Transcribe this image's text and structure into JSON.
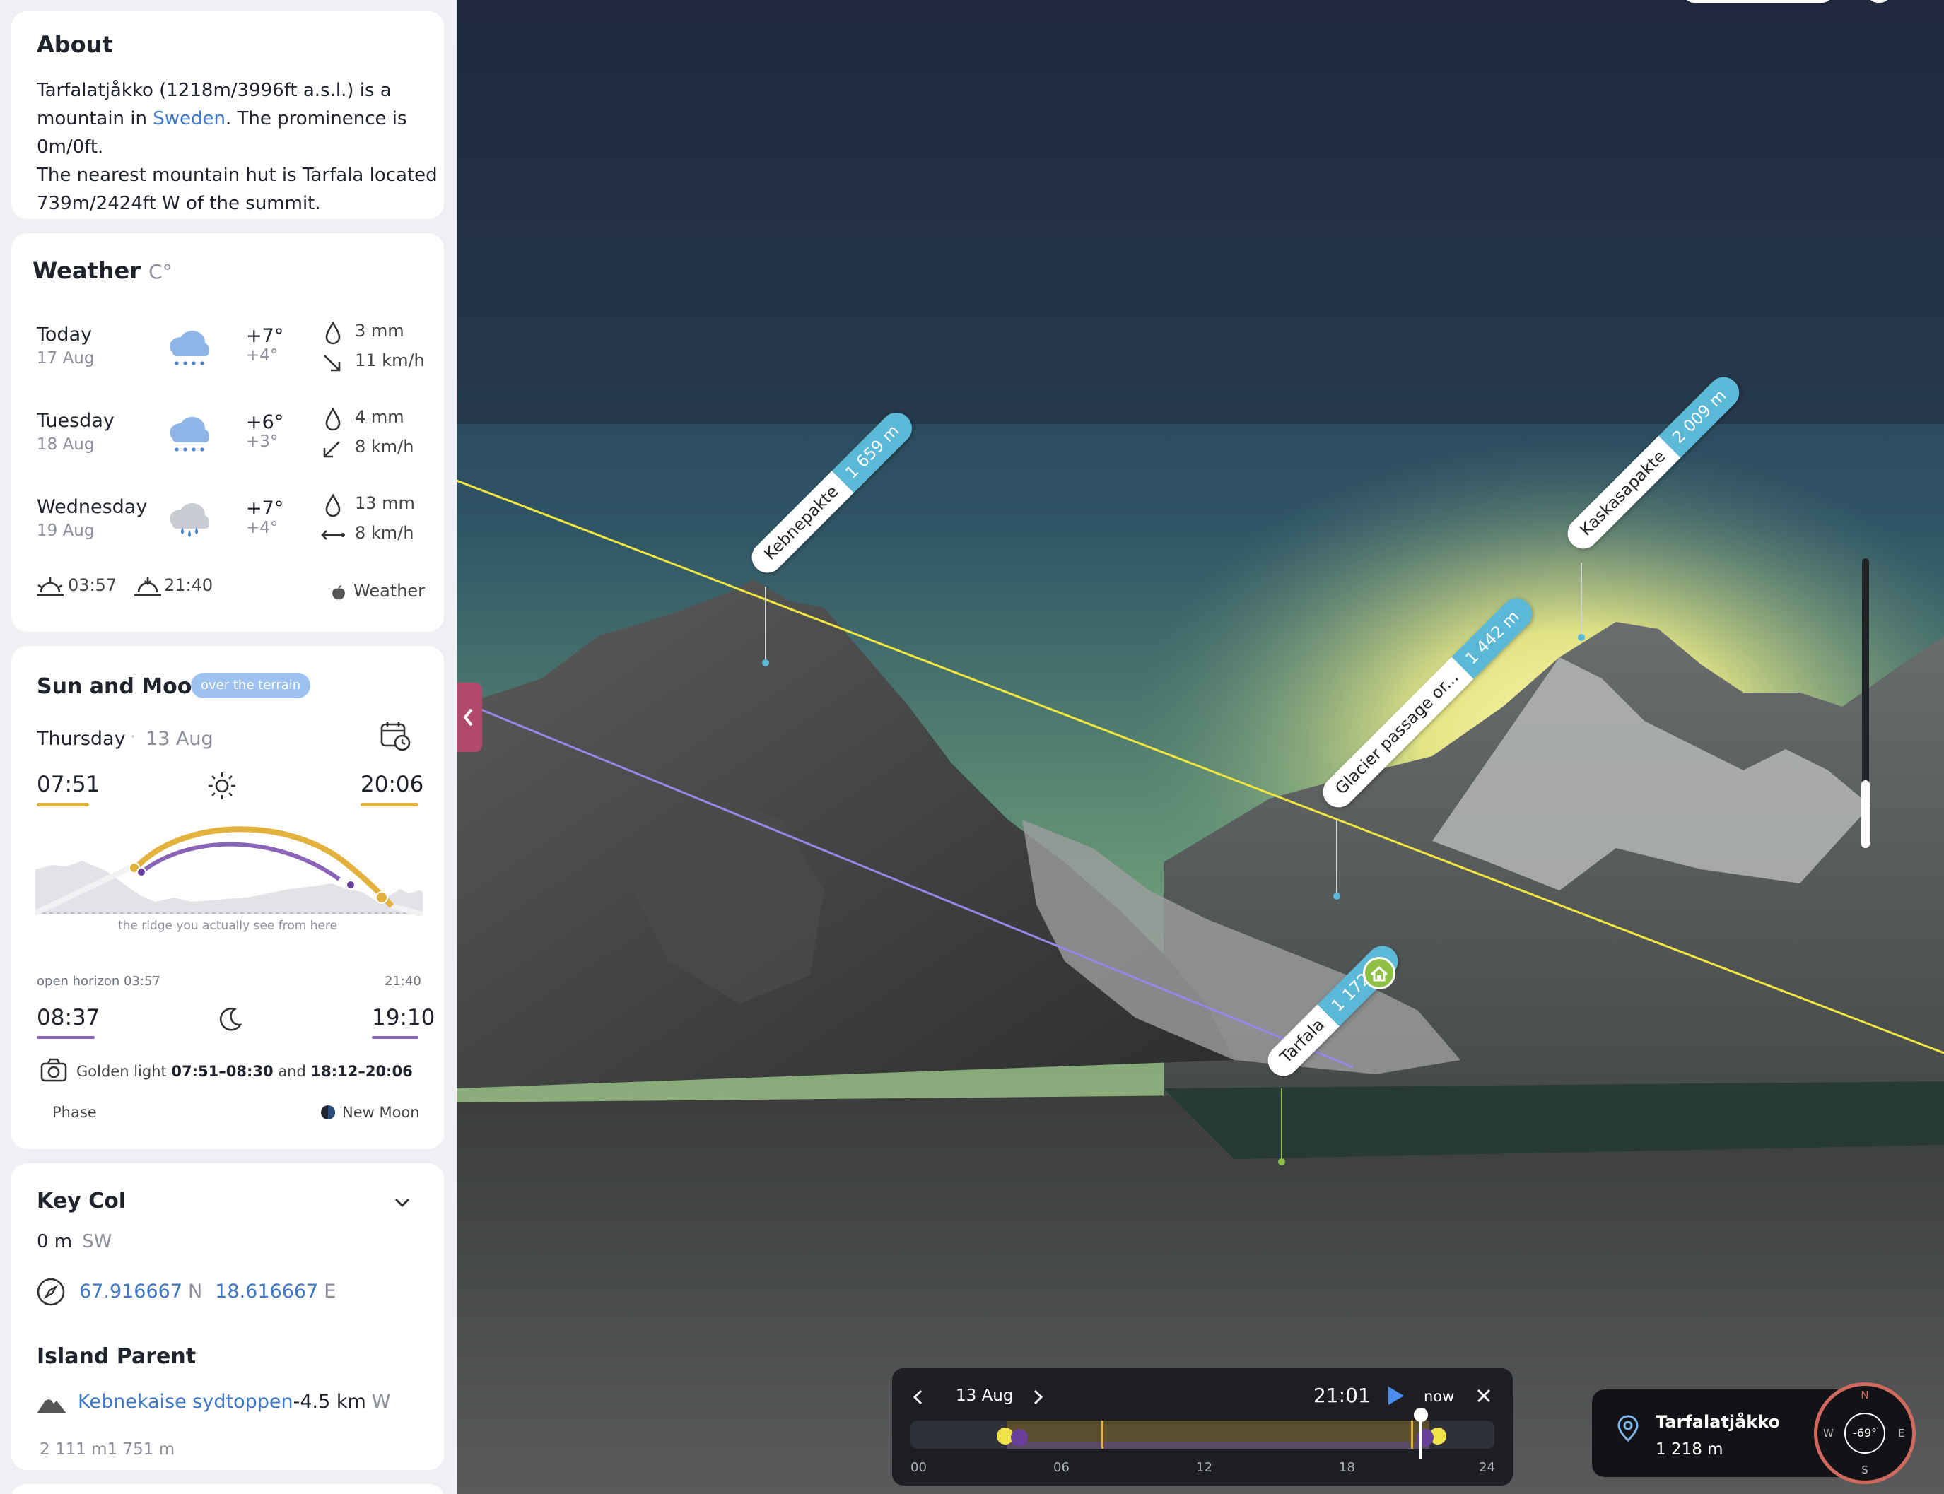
{
  "about": {
    "title": "About",
    "lines": [
      [
        "Tarfalatjåkko (1218m/3996ft a.s.l.) is a",
        ""
      ],
      [
        "mountain in ",
        "Sweden",
        ". The prominence is"
      ],
      [
        "0m/0ft.",
        ""
      ],
      [
        "The nearest mountain hut is Tarfala located",
        ""
      ],
      [
        "739m/2424ft W of the summit.",
        ""
      ]
    ],
    "l1": "Tarfalatjåkko (1218m/3996ft a.s.l.) is a",
    "l2a": "mountain in ",
    "l2link": "Sweden",
    "l2b": ". The prominence is",
    "l3": "0m/0ft.",
    "l4": "The nearest mountain hut is Tarfala located",
    "l5": "739m/2424ft W of the summit."
  },
  "weather": {
    "title": "Weather",
    "unit": "C°",
    "days": [
      {
        "day": "Today",
        "date": "17 Aug",
        "hi": "+7°",
        "lo": "+4°",
        "rain": "3 mm",
        "wind": "11 km/h",
        "icon": "rain-cloud-icon",
        "wind_icon": "wind-arrow-se-icon"
      },
      {
        "day": "Tuesday",
        "date": "18 Aug",
        "hi": "+6°",
        "lo": "+3°",
        "rain": "4 mm",
        "wind": "8 km/h",
        "icon": "rain-cloud-icon",
        "wind_icon": "wind-arrow-sw-icon"
      },
      {
        "day": "Wednesday",
        "date": "19 Aug",
        "hi": "+7°",
        "lo": "+4°",
        "rain": "13 mm",
        "wind": "8 km/h",
        "icon": "rain-grey-cloud-icon",
        "wind_icon": "wind-arrow-horizontal-icon"
      }
    ],
    "sunrise": "03:57",
    "sunset": "21:40",
    "source": "Weather"
  },
  "sunmoon": {
    "title": "Sun and Moon",
    "badge": "over the terrain",
    "day": "Thursday",
    "date": "13 Aug",
    "sun_rise": "07:51",
    "sun_set": "20:06",
    "ridge_caption": "the ridge you actually see from here",
    "open_horizon": "open horizon 03:57",
    "open_horizon_end": "21:40",
    "moon_rise": "08:37",
    "moon_set": "19:10",
    "golden_prefix": "Golden light ",
    "golden_1": "07:51–08:30",
    "golden_and": " and ",
    "golden_2": "18:12–20:06",
    "phase_label": "Phase",
    "phase_value": "New Moon",
    "sun_color": "#e3b23c",
    "moon_color": "#8a64b8"
  },
  "keycol": {
    "title": "Key Col",
    "elev": "0 m",
    "dir": "SW",
    "lat": "67.916667",
    "lat_dir": "N",
    "lon": "18.616667",
    "lon_dir": "E",
    "island_title": "Island Parent",
    "parent_name": "Kebnekaise sydtoppen",
    "parent_dist": "-4.5 km",
    "parent_dir": "W",
    "parent_elev": "2 111 m",
    "parent_prom": "1 751 m"
  },
  "labels": [
    {
      "name": "Kebnepakte",
      "elev": "1 659 m"
    },
    {
      "name": "Kaskasapakte",
      "elev": "2 009 m"
    },
    {
      "name": "Glacier passage or...",
      "elev": "1 442 m"
    },
    {
      "name": "Tarfala",
      "elev": "1 172 m"
    }
  ],
  "timeline": {
    "date": "13 Aug",
    "time": "21:01",
    "now": "now",
    "ticks": [
      "00",
      "06",
      "12",
      "18",
      "24"
    ]
  },
  "peak": {
    "name": "Tarfalatjåkko",
    "elev": "1 218 m",
    "heading": "-69°",
    "n": "N",
    "e": "E",
    "s": "S",
    "w": "W"
  },
  "colors": {
    "accent": "#3f78c6",
    "label_blue": "#5bb8d6",
    "sun_line": "#f2e640",
    "moon_line": "#9a86e8"
  }
}
